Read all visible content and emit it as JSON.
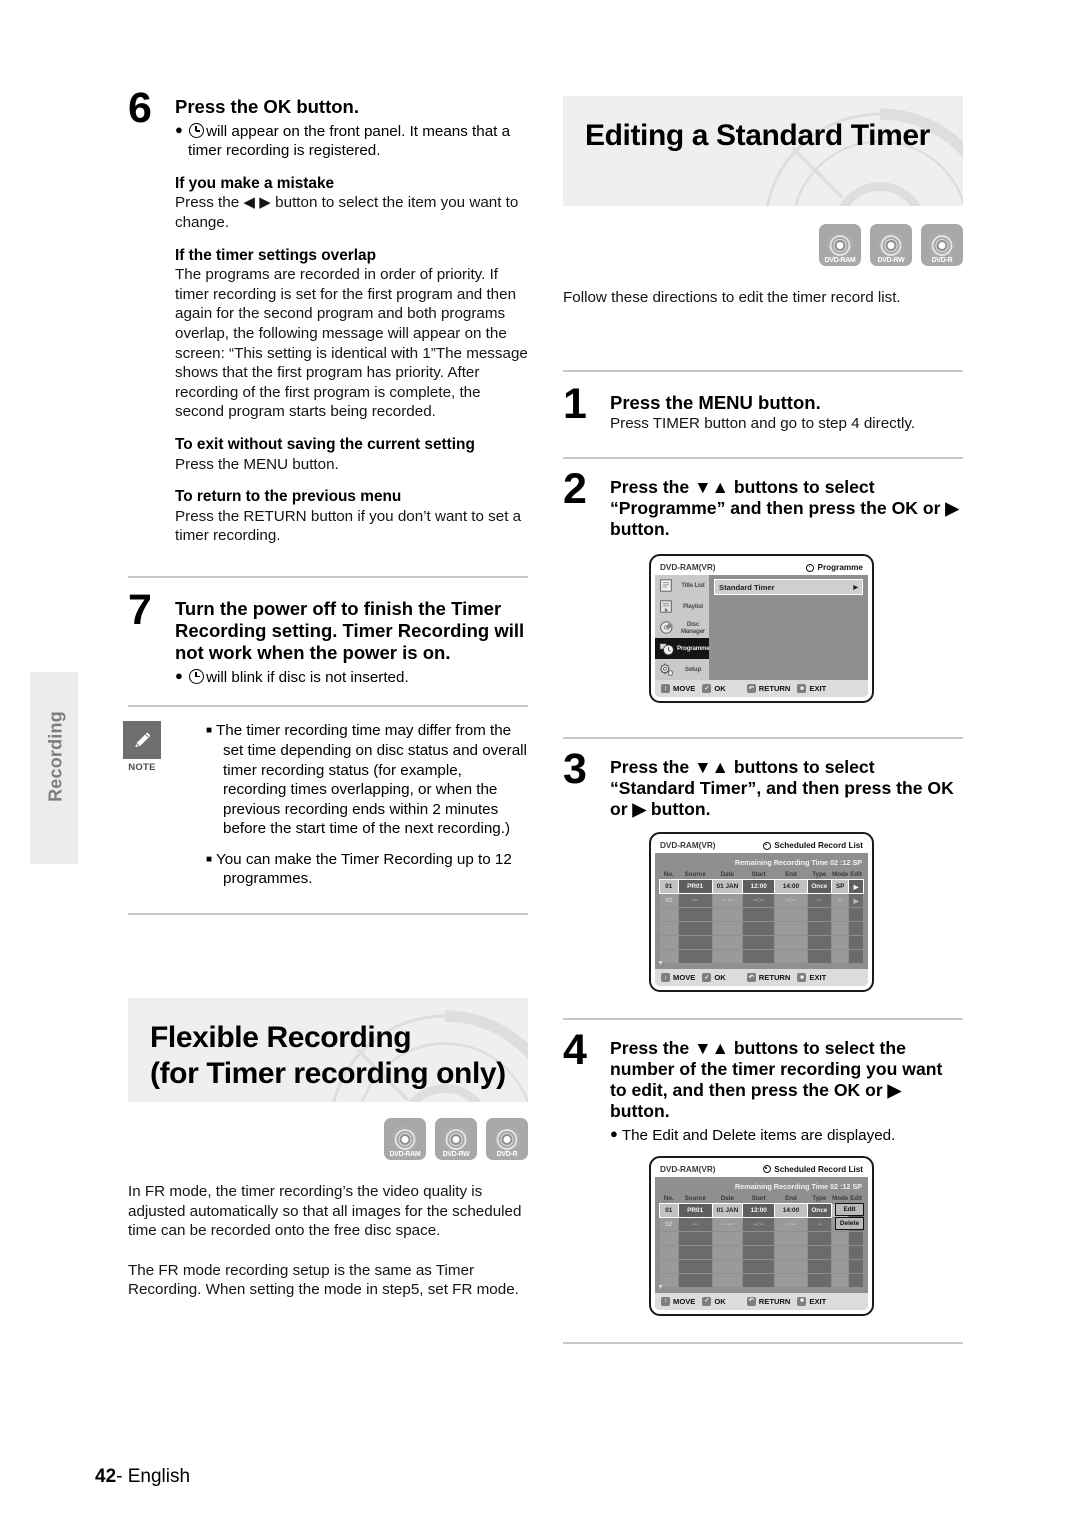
{
  "page": {
    "number": "42",
    "language": "English",
    "side_tab_label": "Recording"
  },
  "left_column": {
    "step6": {
      "number": "6",
      "title": "Press the OK button.",
      "bullet": "will appear on the front panel. It means that a timer recording is registered.",
      "subsections": [
        {
          "heading": "If you make a mistake",
          "body": "Press the ◀ ▶ button to select the item you want to change."
        },
        {
          "heading": "If the timer settings overlap",
          "body": "The programs are recorded in order of priority. If timer recording is set for the first program and then again for the second program and both programs overlap, the following message will appear on the screen: “This setting is identical with 1”The message shows that the first program has priority. After recording of the first program is complete, the second program starts being recorded."
        },
        {
          "heading": "To exit without saving the current setting",
          "body": "Press the MENU button."
        },
        {
          "heading": "To return to the previous menu",
          "body": "Press the RETURN button if you don’t want to set a timer recording."
        }
      ]
    },
    "step7": {
      "number": "7",
      "title": "Turn the power off to finish the Timer Recording setting. Timer Recording will not work when the power is on.",
      "bullet": "will blink if disc is not inserted."
    },
    "note": {
      "label": "NOTE",
      "items": [
        "The timer recording time may differ from the set time depending on disc status and overall timer recording status (for example, recording times overlapping, or when the previous recording ends within 2 minutes before the start time of the next recording.)",
        "You can make the Timer Recording up to 12 programmes."
      ]
    },
    "flexible_recording": {
      "title_line1": "Flexible Recording",
      "title_line2": "(for Timer recording only)",
      "badges": [
        "DVD-RAM",
        "DVD-RW",
        "DVD-R"
      ],
      "paragraph1": "In FR mode, the timer recording’s the video quality is adjusted automatically so that all images for the scheduled time can be recorded onto the free disc space.",
      "paragraph2": "The FR mode recording setup is the same as Timer Recording. When setting the mode in step5, set FR mode."
    }
  },
  "right_column": {
    "banner": {
      "title": "Editing a Standard Timer",
      "badges": [
        "DVD-RAM",
        "DVD-RW",
        "DVD-R"
      ],
      "intro": "Follow these directions to edit the timer record list."
    },
    "step1": {
      "number": "1",
      "title": "Press the MENU button.",
      "body": "Press TIMER button and go to step 4 directly."
    },
    "step2": {
      "number": "2",
      "title": "Press the ▼▲ buttons to select “Programme” and then press the OK or ▶ button."
    },
    "step3": {
      "number": "3",
      "title": "Press the ▼▲ buttons to select “Standard Timer”, and then press the OK or ▶ button."
    },
    "step4": {
      "number": "4",
      "title": "Press the ▼▲ buttons to select the number of the timer recording you want to edit, and then press the OK or ▶ button.",
      "bullet": "The Edit and Delete items are displayed."
    }
  },
  "screen_programme": {
    "disc_label": "DVD-RAM(VR)",
    "header_title": "Programme",
    "sidebar": [
      {
        "label": "Title List",
        "selected": false
      },
      {
        "label": "Playlist",
        "selected": false
      },
      {
        "label": "Disc Manager",
        "selected": false
      },
      {
        "label": "Programme",
        "selected": true
      },
      {
        "label": "Setup",
        "selected": false
      }
    ],
    "selected_item": "Standard Timer",
    "footer": [
      {
        "key": "↕",
        "label": "MOVE"
      },
      {
        "key": "✓",
        "label": "OK"
      },
      {
        "key": "↶",
        "label": "RETURN"
      },
      {
        "key": "■",
        "label": "EXIT"
      }
    ]
  },
  "screen_record_list": {
    "disc_label": "DVD-RAM(VR)",
    "header_title": "Scheduled Record List",
    "remaining": "Remaining Recording Time 02 :12 SP",
    "columns": [
      "No.",
      "Source",
      "Date",
      "Start",
      "End",
      "Type",
      "Mode",
      "Edit"
    ],
    "rows": [
      {
        "no": "01",
        "source": "PR01",
        "date": "01 JAN",
        "start": "12:00",
        "end": "14:00",
        "type": "Once",
        "mode": "SP",
        "edit": "▶"
      },
      {
        "no": "02",
        "source": "---",
        "date": "-- ---",
        "start": "--:--",
        "end": "--:--",
        "type": "--",
        "mode": "--",
        "edit": "▶"
      }
    ],
    "blank_rows": 4,
    "footer": [
      {
        "key": "↕",
        "label": "MOVE"
      },
      {
        "key": "✓",
        "label": "OK"
      },
      {
        "key": "↶",
        "label": "RETURN"
      },
      {
        "key": "■",
        "label": "EXIT"
      }
    ]
  },
  "screen_record_list_edit": {
    "disc_label": "DVD-RAM(VR)",
    "header_title": "Scheduled Record List",
    "remaining": "Remaining Recording Time 02 :12 SP",
    "columns": [
      "No.",
      "Source",
      "Date",
      "Start",
      "End",
      "Type",
      "Mode",
      "Edit"
    ],
    "rows": [
      {
        "no": "01",
        "source": "PR01",
        "date": "01 JAN",
        "start": "12:00",
        "end": "14:00",
        "type": "Once",
        "mode": "",
        "edit": ""
      },
      {
        "no": "02",
        "source": "---",
        "date": "-- ---",
        "start": "--:--",
        "end": "--:--",
        "type": "--",
        "mode": "",
        "edit": ""
      }
    ],
    "popup": {
      "edit": "Edit",
      "delete": "Delete"
    },
    "blank_rows": 4,
    "footer": [
      {
        "key": "↕",
        "label": "MOVE"
      },
      {
        "key": "✓",
        "label": "OK"
      },
      {
        "key": "↶",
        "label": "RETURN"
      },
      {
        "key": "■",
        "label": "EXIT"
      }
    ]
  }
}
